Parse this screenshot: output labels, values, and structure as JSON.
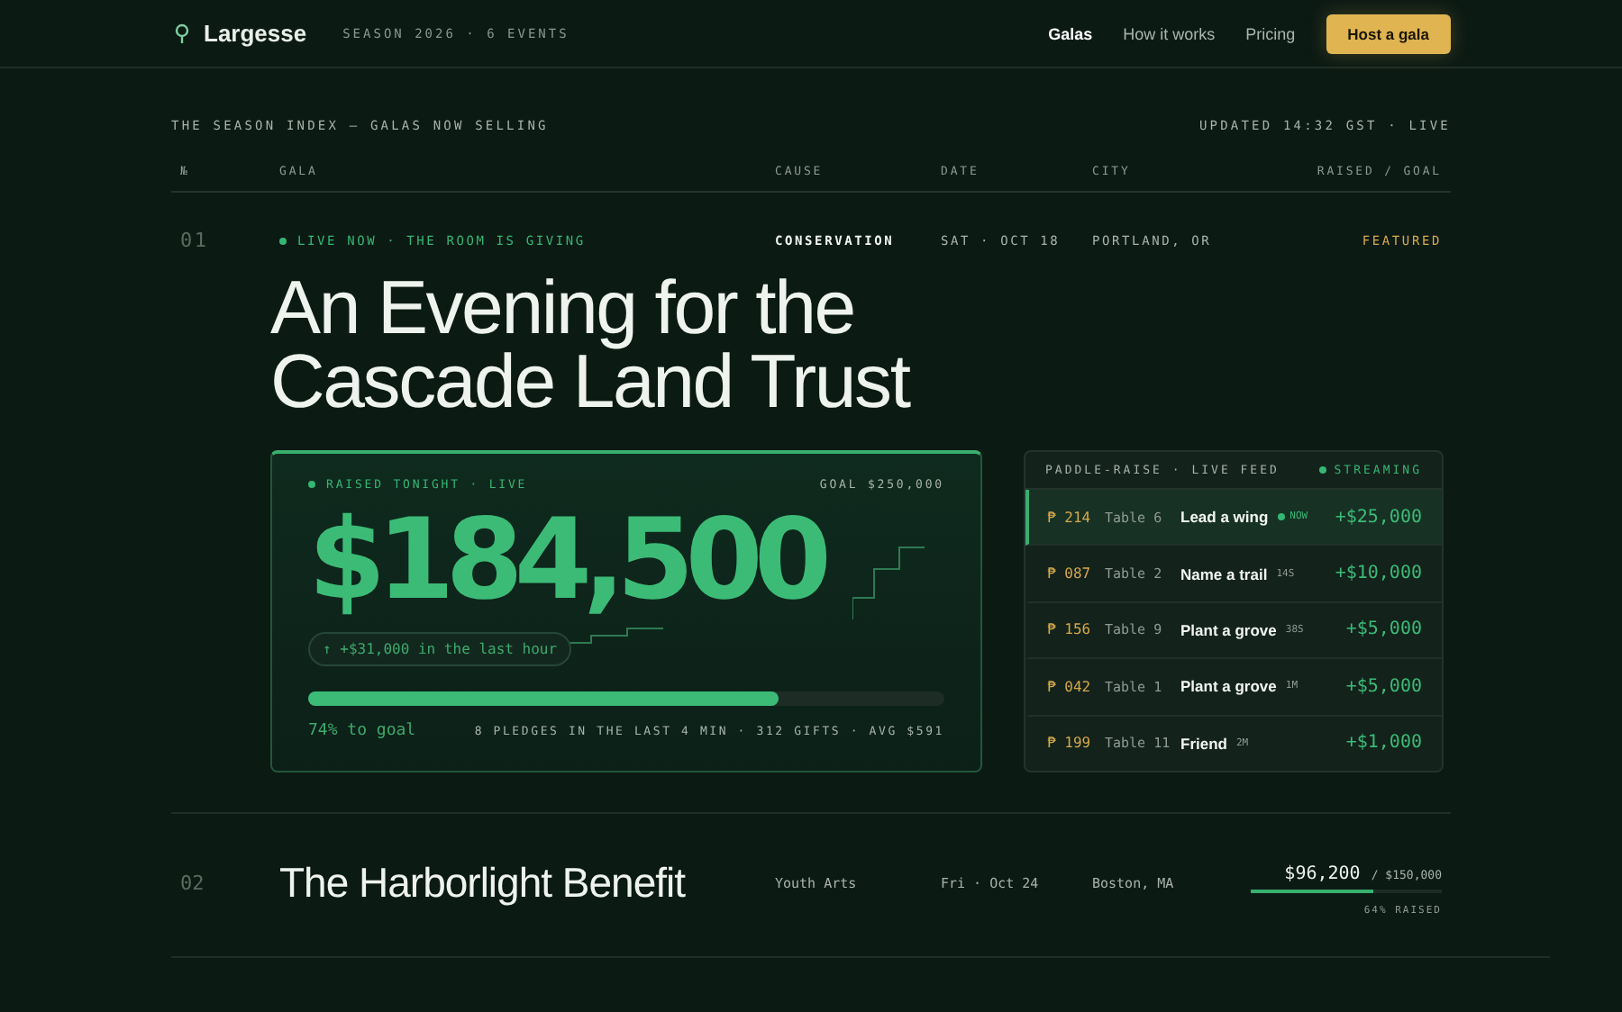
{
  "header": {
    "brand": "Largesse",
    "season": "SEASON 2026 · 6 EVENTS",
    "nav": [
      {
        "label": "Galas",
        "selected": true
      },
      {
        "label": "How it works",
        "selected": false
      },
      {
        "label": "Pricing",
        "selected": false
      }
    ],
    "cta": "Host a gala"
  },
  "index": {
    "title": "THE SEASON INDEX — GALAS NOW SELLING",
    "updated": "UPDATED 14:32 GST · LIVE",
    "columns": [
      "№",
      "GALA",
      "CAUSE",
      "DATE",
      "CITY",
      "RAISED / GOAL"
    ]
  },
  "featured": {
    "number": "01",
    "status": "LIVE NOW · THE ROOM IS GIVING",
    "cause": "CONSERVATION",
    "date": "SAT · OCT 18",
    "city": "PORTLAND, OR",
    "badge": "FEATURED",
    "title": "An Evening for the Cascade Land Trust",
    "raised": {
      "label": "RAISED TONIGHT · LIVE",
      "goal": "GOAL $250,000",
      "amount": "$184,500",
      "delta": "↑ +$31,000 in the last hour",
      "level": 0.74,
      "to_goal": "74% to goal",
      "stats": "8 PLEDGES IN THE LAST 4 MIN · 312 GIFTS · AVG $591"
    },
    "feed": {
      "title": "PADDLE-RAISE · LIVE FEED",
      "status": "STREAMING",
      "rows": [
        {
          "paddle": "₱ 214",
          "table": "Table 6",
          "item": "Lead a wing",
          "time": "NOW",
          "amount": "+$25,000",
          "latest": true
        },
        {
          "paddle": "₱ 087",
          "table": "Table 2",
          "item": "Name a trail",
          "time": "14S",
          "amount": "+$10,000",
          "latest": false
        },
        {
          "paddle": "₱ 156",
          "table": "Table 9",
          "item": "Plant a grove",
          "time": "38S",
          "amount": "+$5,000",
          "latest": false
        },
        {
          "paddle": "₱ 042",
          "table": "Table 1",
          "item": "Plant a grove",
          "time": "1M",
          "amount": "+$5,000",
          "latest": false
        },
        {
          "paddle": "₱ 199",
          "table": "Table 11",
          "item": "Friend",
          "time": "2M",
          "amount": "+$1,000",
          "latest": false
        }
      ]
    }
  },
  "galas": [
    {
      "number": "02",
      "title": "The Harborlight Benefit",
      "cause": "Youth Arts",
      "date": "Fri · Oct 24",
      "city": "Boston, MA",
      "raised": "$96,200",
      "goal": "/ $150,000",
      "level": 0.64,
      "percent": "64% RAISED"
    }
  ]
}
